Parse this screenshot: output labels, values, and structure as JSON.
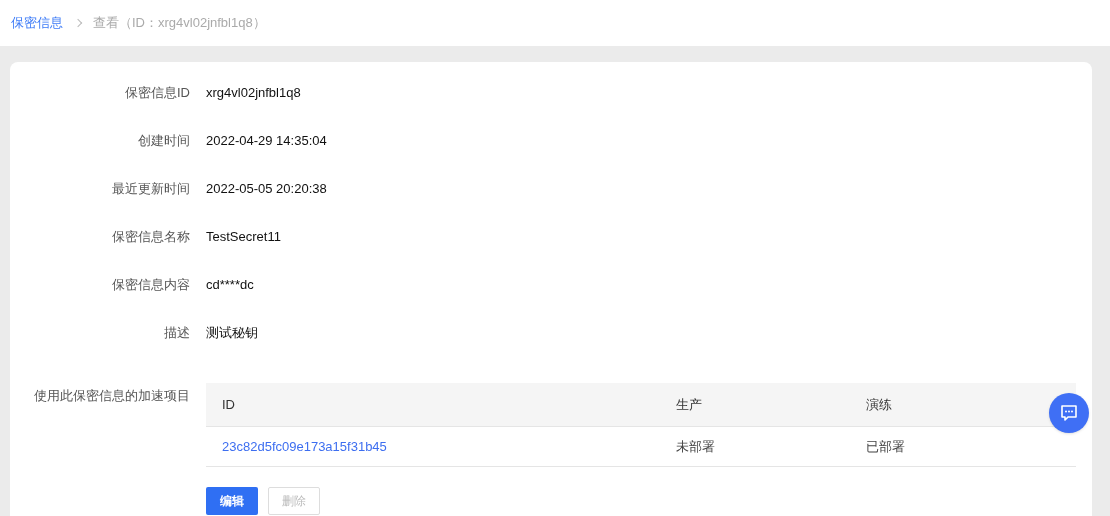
{
  "breadcrumb": [
    {
      "label": "保密信息",
      "kind": "link"
    },
    {
      "label": "查看（ID：xrg4vl02jnfbl1q8）",
      "kind": "current"
    }
  ],
  "fields": [
    {
      "label": "保密信息ID",
      "value": "xrg4vl02jnfbl1q8"
    },
    {
      "label": "创建时间",
      "value": "2022-04-29 14:35:04"
    },
    {
      "label": "最近更新时间",
      "value": "2022-05-05 20:20:38"
    },
    {
      "label": "保密信息名称",
      "value": "TestSecret11"
    },
    {
      "label": "保密信息内容",
      "value": "cd****dc"
    },
    {
      "label": "描述",
      "value": "测试秘钥"
    }
  ],
  "projects": {
    "label": "使用此保密信息的加速项目",
    "columns": [
      "ID",
      "生产",
      "演练"
    ],
    "rows": [
      {
        "id": "23c82d5fc09e173a15f31b45",
        "production": "未部署",
        "drill": "已部署"
      }
    ]
  },
  "buttons": [
    {
      "label": "编辑",
      "disabled": false
    },
    {
      "label": "删除",
      "disabled": true
    }
  ]
}
